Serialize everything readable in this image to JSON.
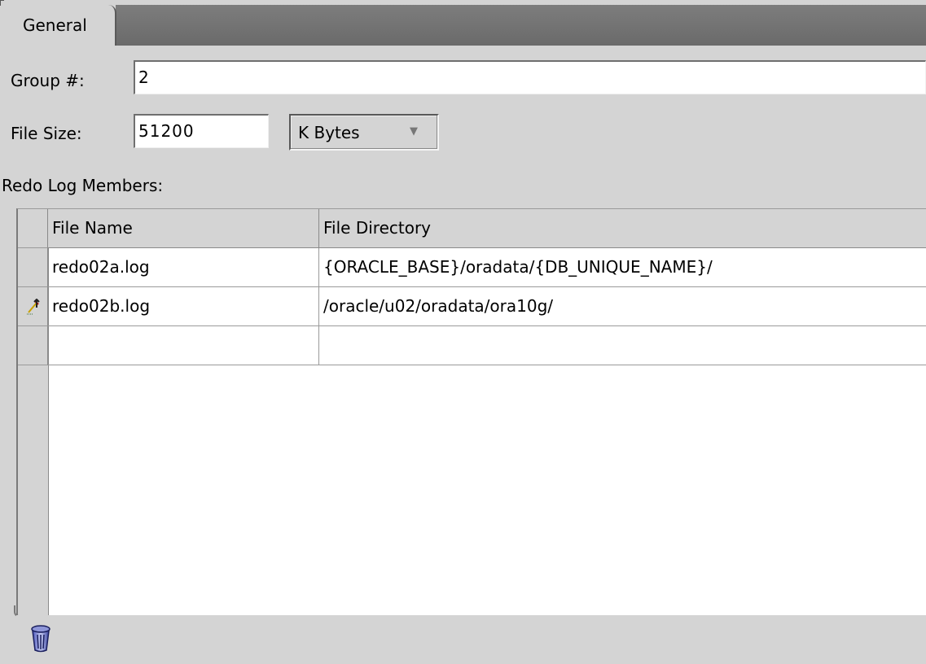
{
  "tabs": [
    {
      "label": "General",
      "active": true
    }
  ],
  "form": {
    "group_label": "Group #:",
    "group_value": "2",
    "size_label": "File Size:",
    "size_value": "51200",
    "size_unit": "K Bytes",
    "members_label": "Redo Log Members:"
  },
  "table": {
    "columns": [
      "File Name",
      "File Directory"
    ],
    "rows": [
      {
        "file_name": "redo02a.log",
        "directory": "{ORACLE_BASE}/oradata/{DB_UNIQUE_NAME}/",
        "row_icon": ""
      },
      {
        "file_name": "redo02b.log",
        "directory": "/oracle/u02/oradata/ora10g/",
        "row_icon": "edit-pencil-icon"
      },
      {
        "file_name": "",
        "directory": "",
        "row_icon": ""
      }
    ]
  },
  "toolbar": {
    "delete_icon": "trash-icon"
  }
}
